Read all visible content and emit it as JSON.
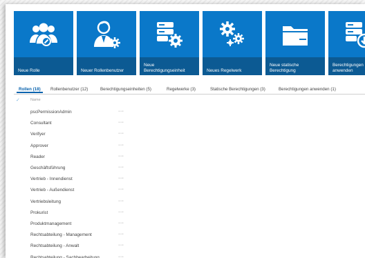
{
  "toolbar": {
    "tiles": [
      {
        "label": "Neue Rolle",
        "icon": "group-icon"
      },
      {
        "label": "Neuer Rollenbenutzer",
        "icon": "user-settings-icon"
      },
      {
        "label": "Neue\nBerechtigungseinheit",
        "icon": "database-settings-icon"
      },
      {
        "label": "Neues Regelwerk",
        "icon": "gears-icon"
      },
      {
        "label": "Neue statische\nBerechtigung",
        "icon": "folder-icon"
      },
      {
        "label": "Berechtigungen\nanwenden",
        "icon": "database-download-icon"
      }
    ]
  },
  "tabs": [
    {
      "label": "Rollen (18)",
      "active": true
    },
    {
      "label": "Rollenbenutzer (12)"
    },
    {
      "label": "Berechtigungseinheiten (5)"
    },
    {
      "label": "Regelwerke (3)"
    },
    {
      "label": "Statische Berechtigungen (3)"
    },
    {
      "label": "Berechtigungen anwenden (1)"
    }
  ],
  "list": {
    "header_name": "Name",
    "menu_glyph": "···",
    "rows": [
      "pscPermissionAdmin",
      "Consultant",
      "Verifyer",
      "Approver",
      "Reader",
      "Geschäftsführung",
      "Vertrieb - Innendienst",
      "Vertrieb - Außendienst",
      "Vertriebsleitung",
      "Prokurist",
      "Produktmanagement",
      "Rechtsabteilung - Management",
      "Rechtsabteilung - Anwalt",
      "Rechtsabteilung - Sachbearbeitung"
    ]
  },
  "colors": {
    "tile": "#0a78c9",
    "tile_caption": "#0c5a93",
    "accent": "#0a63ae"
  }
}
